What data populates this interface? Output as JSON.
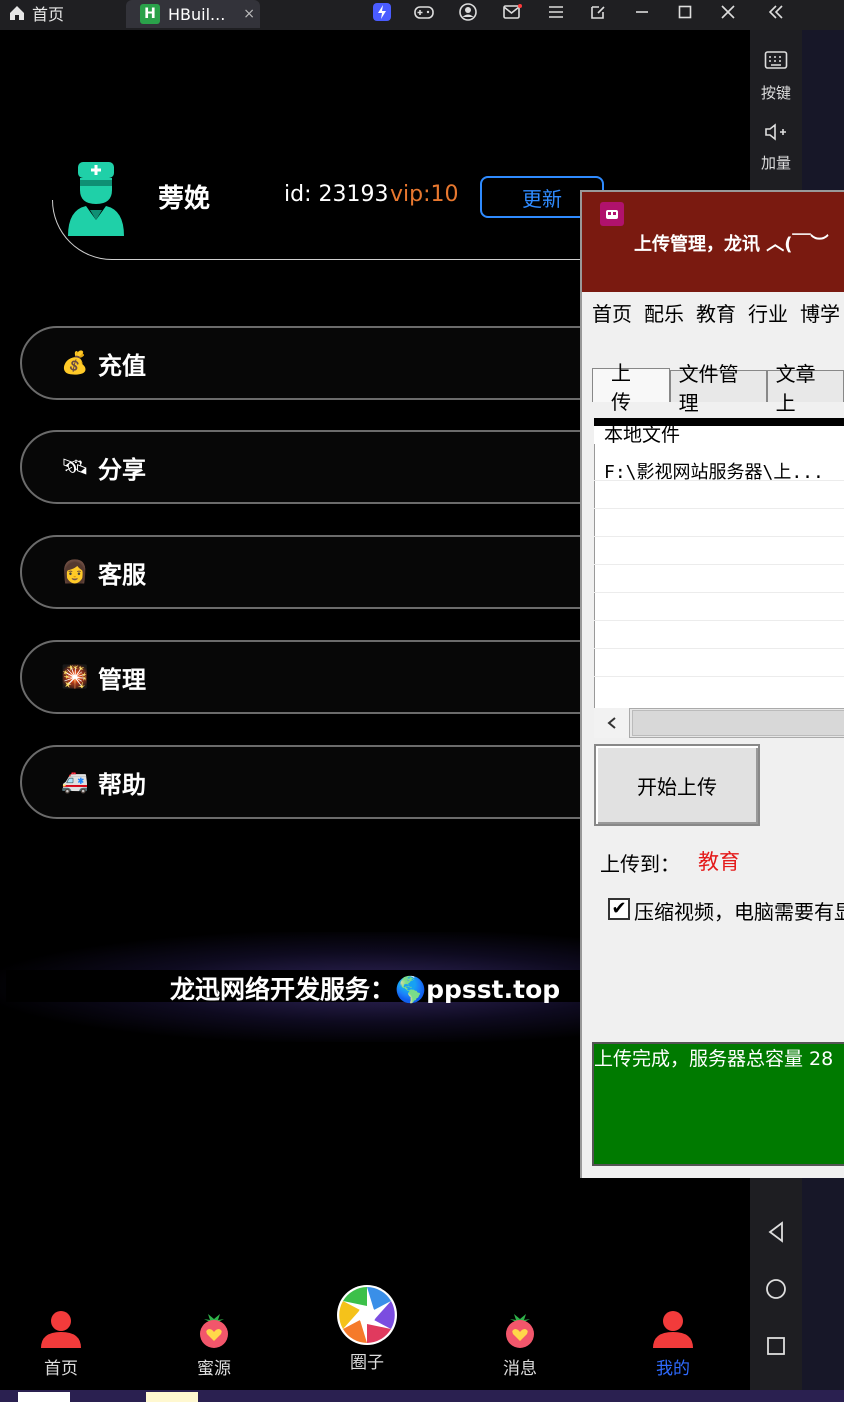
{
  "topbar": {
    "home_tab_label": "首页",
    "active_tab_label": "HBuil...",
    "active_tab_logo": "H",
    "close_glyph": "×",
    "icons": [
      "lightning-icon",
      "gamepad-icon",
      "user-circle-icon",
      "mail-icon",
      "menu-icon",
      "external-icon",
      "minimize-icon",
      "maximize-icon",
      "close-icon",
      "collapse-icon"
    ]
  },
  "side_panel": {
    "keys_label": "按键",
    "volume_label": "加量"
  },
  "profile": {
    "name": "蒡娩",
    "id_text": "id: 23193",
    "vip_text": "vip:10",
    "update_label": "更新"
  },
  "menu": {
    "items": [
      {
        "emoji": "💰",
        "label": "充值"
      },
      {
        "emoji": "🛰",
        "label": "分享"
      },
      {
        "emoji": "👩",
        "label": "客服"
      },
      {
        "emoji": "🎇",
        "label": "管理"
      },
      {
        "emoji": "🚑",
        "label": "帮助"
      }
    ]
  },
  "banner": {
    "text": "龙迅网络开发服务：🌎ppsst.top"
  },
  "tabbar": {
    "items": [
      {
        "label": "首页"
      },
      {
        "label": "蜜源"
      },
      {
        "label": "圈子"
      },
      {
        "label": "消息"
      },
      {
        "label": "我的"
      }
    ],
    "active_index": 4
  },
  "window": {
    "title": "上传管理，龙讯 ︿(￣︶",
    "menu": [
      "首页",
      "配乐",
      "教育",
      "行业",
      "博学"
    ],
    "tabs": [
      "上传",
      "文件管理",
      "文章上"
    ],
    "list_header": "本地文件",
    "list_rows": [
      "F:\\影视网站服务器\\上..."
    ],
    "start_label": "开始上传",
    "upload_to_label": "上传到：",
    "upload_to_value": "教育",
    "checkbox_label": "压缩视频，电脑需要有显",
    "checkbox_mark": "✔",
    "status_text": "上传完成，服务器总容量 28"
  },
  "colors": {
    "accent_blue": "#2f8bff",
    "vip_orange": "#e8782f",
    "window_title_bg": "#7a1a10",
    "status_green": "#007a00",
    "red_text": "#e41a1a"
  }
}
